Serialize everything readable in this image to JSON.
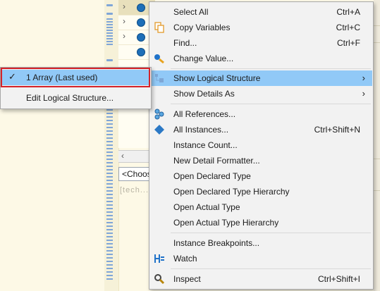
{
  "background": {
    "combo_text": "<Choos",
    "detail_text": "[tech..."
  },
  "context_menu": {
    "items": [
      {
        "label": "Select All",
        "shortcut": "Ctrl+A"
      },
      {
        "label": "Copy Variables",
        "shortcut": "Ctrl+C",
        "icon": "copy-icon"
      },
      {
        "label": "Find...",
        "shortcut": "Ctrl+F"
      },
      {
        "label": "Change Value...",
        "icon": "change-value-icon"
      },
      {
        "label": "Show Logical Structure",
        "icon": "logical-structure-icon",
        "highlighted": true
      },
      {
        "label": "Show Details As"
      },
      {
        "label": "All References...",
        "icon": "references-icon"
      },
      {
        "label": "All Instances...",
        "shortcut": "Ctrl+Shift+N",
        "icon": "instances-icon"
      },
      {
        "label": "Instance Count..."
      },
      {
        "label": "New Detail Formatter..."
      },
      {
        "label": "Open Declared Type"
      },
      {
        "label": "Open Declared Type Hierarchy"
      },
      {
        "label": "Open Actual Type"
      },
      {
        "label": "Open Actual Type Hierarchy"
      },
      {
        "label": "Instance Breakpoints..."
      },
      {
        "label": "Watch",
        "icon": "watch-icon"
      },
      {
        "label": "Inspect",
        "shortcut": "Ctrl+Shift+I",
        "icon": "inspect-icon"
      }
    ]
  },
  "submenu": {
    "items": [
      {
        "label": "1 Array (Last used)",
        "checked": true
      },
      {
        "label": "Edit Logical Structure..."
      }
    ]
  },
  "colors": {
    "highlight": "#91c9f7",
    "callout": "#d3232a",
    "menu_bg": "#f2f2f2"
  }
}
